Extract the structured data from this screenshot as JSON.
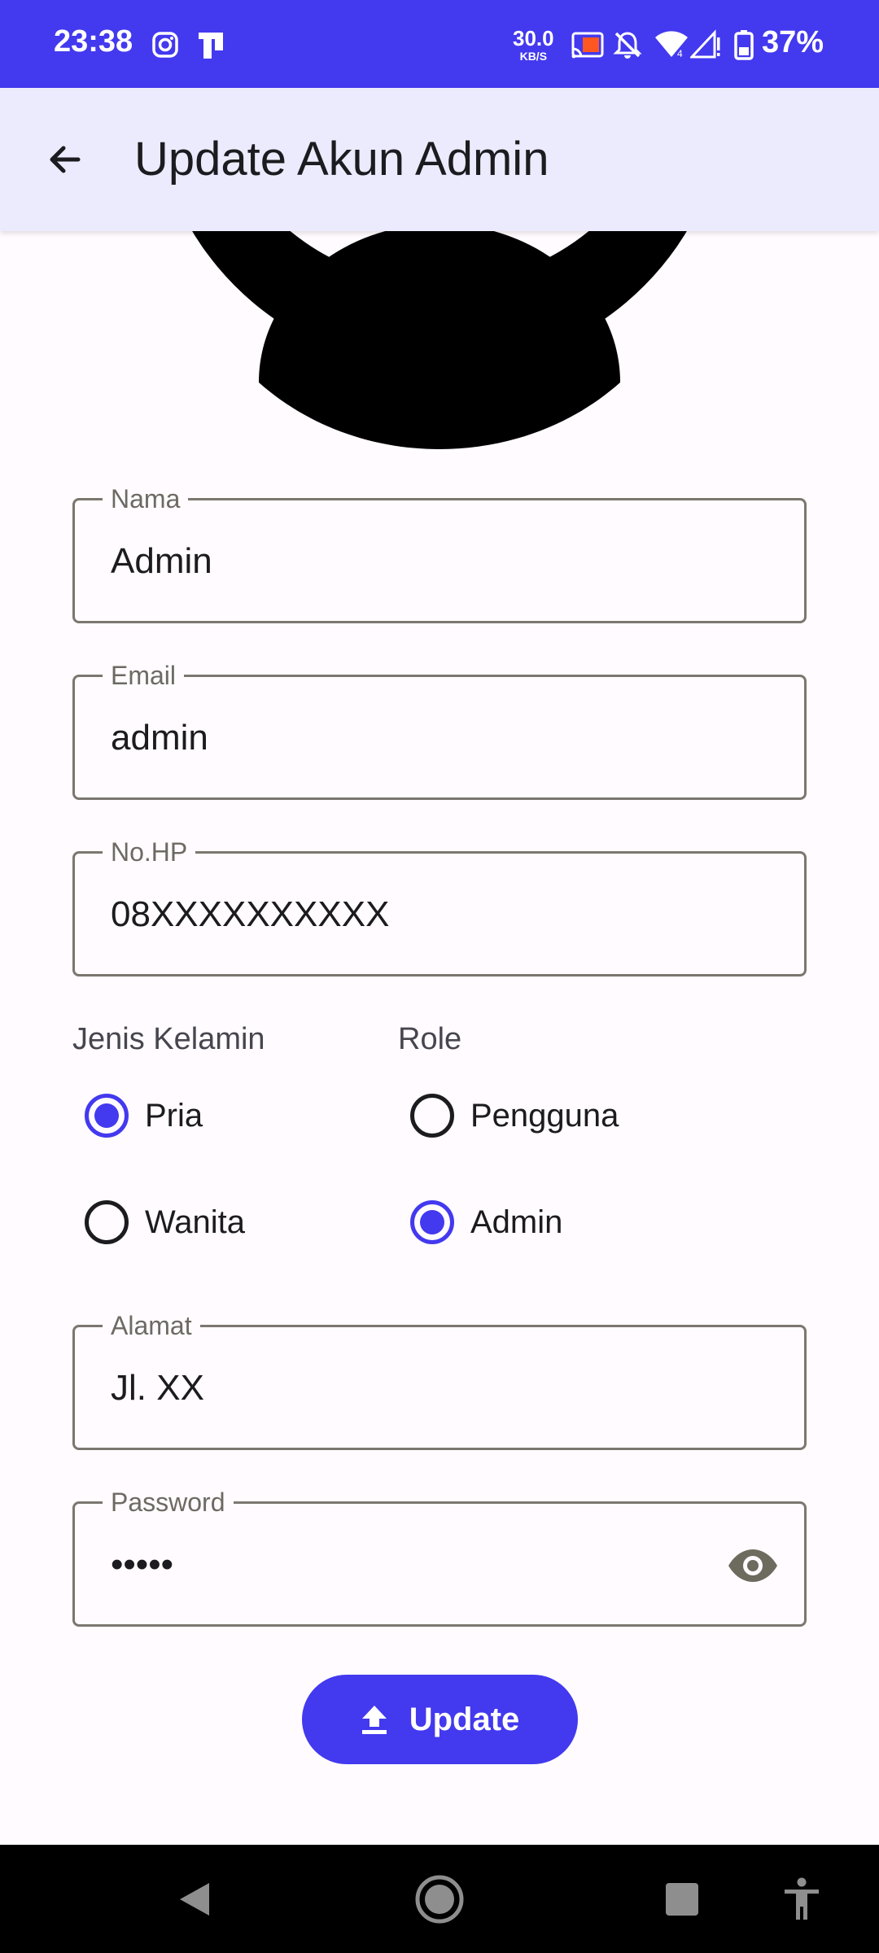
{
  "status_bar": {
    "time": "23:38",
    "net_speed_value": "30.0",
    "net_speed_unit": "KB/S",
    "battery_percent": "37%",
    "color": "#4339ef"
  },
  "app_bar": {
    "title": "Update Akun Admin",
    "back_icon": "arrow-back-icon"
  },
  "avatar": {
    "icon": "person-avatar-icon"
  },
  "form": {
    "nama": {
      "label": "Nama",
      "value": "Admin"
    },
    "email": {
      "label": "Email",
      "value": "admin"
    },
    "no_hp": {
      "label": "No.HP",
      "value": "08XXXXXXXXXX"
    },
    "gender": {
      "label": "Jenis Kelamin",
      "options": [
        {
          "label": "Pria",
          "checked": true
        },
        {
          "label": "Wanita",
          "checked": false
        }
      ]
    },
    "role": {
      "label": "Role",
      "options": [
        {
          "label": "Pengguna",
          "checked": false
        },
        {
          "label": "Admin",
          "checked": true
        }
      ]
    },
    "alamat": {
      "label": "Alamat",
      "value": "Jl. XX"
    },
    "password": {
      "label": "Password",
      "value": "•••••",
      "toggle_icon": "eye-icon"
    }
  },
  "update_button": {
    "label": "Update",
    "icon": "upload-icon"
  },
  "nav_bar": {
    "items": [
      "back-triangle-icon",
      "home-circle-icon",
      "recents-square-icon",
      "accessibility-icon"
    ]
  },
  "colors": {
    "accent": "#4339ef",
    "app_bar_bg": "#ecebfd",
    "background": "#fffbff"
  }
}
